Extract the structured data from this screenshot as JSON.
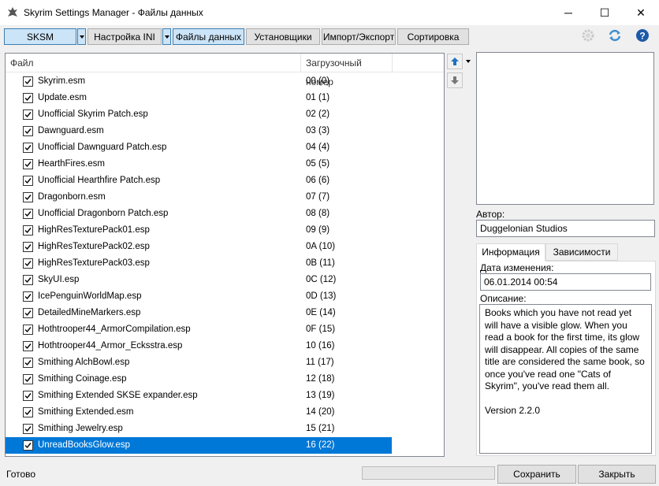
{
  "window": {
    "title": "Skyrim Settings Manager - Файлы данных",
    "minimize_glyph": "─",
    "maximize_glyph": "☐",
    "close_glyph": "✕"
  },
  "toolbar": {
    "skse_label": "SKSM",
    "ini_label": "Настройка INI",
    "data_files_label": "Файлы данных",
    "installers_label": "Установщики",
    "import_export_label": "Импорт/Экспорт",
    "sort_label": "Сортировка",
    "icons": [
      "gear-icon",
      "refresh-icon",
      "help-icon"
    ]
  },
  "list": {
    "columns": [
      "Файл",
      "Загрузочный номер"
    ],
    "rows": [
      {
        "name": "Skyrim.esm",
        "index": "00 (0)",
        "checked": true
      },
      {
        "name": "Update.esm",
        "index": "01 (1)",
        "checked": true
      },
      {
        "name": "Unofficial Skyrim Patch.esp",
        "index": "02 (2)",
        "checked": true
      },
      {
        "name": "Dawnguard.esm",
        "index": "03 (3)",
        "checked": true
      },
      {
        "name": "Unofficial Dawnguard Patch.esp",
        "index": "04 (4)",
        "checked": true
      },
      {
        "name": "HearthFires.esm",
        "index": "05 (5)",
        "checked": true
      },
      {
        "name": "Unofficial Hearthfire Patch.esp",
        "index": "06 (6)",
        "checked": true
      },
      {
        "name": "Dragonborn.esm",
        "index": "07 (7)",
        "checked": true
      },
      {
        "name": "Unofficial Dragonborn Patch.esp",
        "index": "08 (8)",
        "checked": true
      },
      {
        "name": "HighResTexturePack01.esp",
        "index": "09 (9)",
        "checked": true
      },
      {
        "name": "HighResTexturePack02.esp",
        "index": "0A (10)",
        "checked": true
      },
      {
        "name": "HighResTexturePack03.esp",
        "index": "0B (11)",
        "checked": true
      },
      {
        "name": "SkyUI.esp",
        "index": "0C (12)",
        "checked": true
      },
      {
        "name": "IcePenguinWorldMap.esp",
        "index": "0D (13)",
        "checked": true
      },
      {
        "name": "DetailedMineMarkers.esp",
        "index": "0E (14)",
        "checked": true
      },
      {
        "name": "Hothtrooper44_ArmorCompilation.esp",
        "index": "0F (15)",
        "checked": true
      },
      {
        "name": "Hothtrooper44_Armor_Ecksstra.esp",
        "index": "10 (16)",
        "checked": true
      },
      {
        "name": "Smithing AlchBowl.esp",
        "index": "11 (17)",
        "checked": true
      },
      {
        "name": "Smithing Coinage.esp",
        "index": "12 (18)",
        "checked": true
      },
      {
        "name": "Smithing Extended SKSE expander.esp",
        "index": "13 (19)",
        "checked": true
      },
      {
        "name": "Smithing Extended.esm",
        "index": "14 (20)",
        "checked": true
      },
      {
        "name": "Smithing Jewelry.esp",
        "index": "15 (21)",
        "checked": true
      },
      {
        "name": "UnreadBooksGlow.esp",
        "index": "16 (22)",
        "checked": true,
        "selected": true
      }
    ]
  },
  "details": {
    "author_label": "Автор:",
    "author_value": "Duggelonian Studios",
    "tabs": [
      "Информация",
      "Зависимости"
    ],
    "active_tab": "Информация",
    "date_label": "Дата изменения:",
    "date_value": "06.01.2014 00:54",
    "description_label": "Описание:",
    "description": "Books which you have not read yet will have a visible glow.  When you read a book for the first time, its glow will disappear.  All copies of the same title are considered the same book, so once you've read one \"Cats of Skyrim\", you've read them all.\n\nVersion 2.2.0"
  },
  "status": {
    "text": "Готово",
    "progress": 0,
    "save_label": "Сохранить",
    "close_label": "Закрыть"
  },
  "colors": {
    "accent": "#0078d7",
    "toolbar_active": "#cce4f7",
    "arrow_blue": "#1e73be"
  }
}
